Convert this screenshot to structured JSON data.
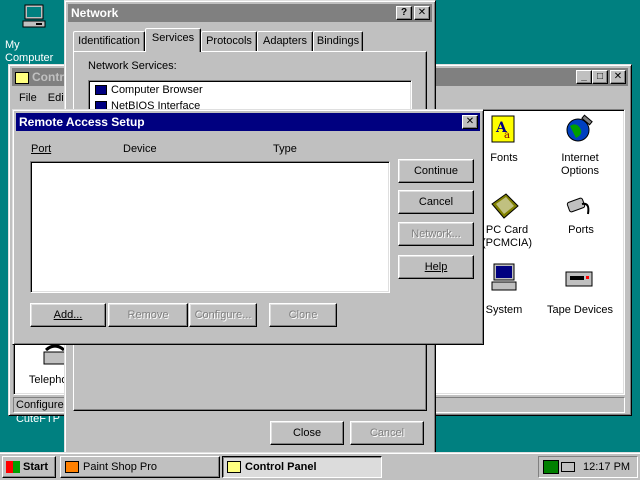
{
  "desktop": {
    "my_computer_label": "My Computer",
    "cuteftp_label": "CuteFTP"
  },
  "control_panel": {
    "title": "Control Panel",
    "menu": [
      "File",
      "Edit"
    ],
    "status_text": "Configures",
    "icons": [
      {
        "label": "Fonts",
        "icon": "fonts-icon"
      },
      {
        "label": "Internet Options",
        "icon": "internet-options-icon"
      },
      {
        "label": "PC Card (PCMCIA)",
        "icon": "pc-card-icon"
      },
      {
        "label": "Ports",
        "icon": "ports-icon"
      },
      {
        "label": "System",
        "icon": "system-icon"
      },
      {
        "label": "Tape Devices",
        "icon": "tape-devices-icon"
      },
      {
        "label": "Telephony",
        "icon": "telephony-icon"
      }
    ],
    "visible_labels": {
      "fonts": "Fonts",
      "internet1": "Internet",
      "internet2": "Options",
      "pccard1": "PC Card",
      "pccard2": "(PCMCIA)",
      "ports": "Ports",
      "system": "System",
      "tape": "Tape Devices",
      "telephony": "Telephony"
    }
  },
  "network": {
    "title": "Network",
    "tabs": [
      "Identification",
      "Services",
      "Protocols",
      "Adapters",
      "Bindings"
    ],
    "selected_tab": "Services",
    "services_label": "Network Services:",
    "services": [
      "Computer Browser",
      "NetBIOS Interface"
    ],
    "close_label": "Close",
    "cancel_label": "Cancel"
  },
  "ras": {
    "title": "Remote Access Setup",
    "columns": [
      "Port",
      "Device",
      "Type"
    ],
    "buttons": {
      "continue": "Continue",
      "cancel": "Cancel",
      "network": "Network...",
      "help": "Help",
      "add": "Add...",
      "remove": "Remove",
      "configure": "Configure...",
      "clone": "Clone"
    }
  },
  "taskbar": {
    "start_label": "Start",
    "tasks": [
      {
        "label": "Paint Shop Pro",
        "active": false
      },
      {
        "label": "Control Panel",
        "active": true
      }
    ],
    "clock": "12:17 PM"
  }
}
